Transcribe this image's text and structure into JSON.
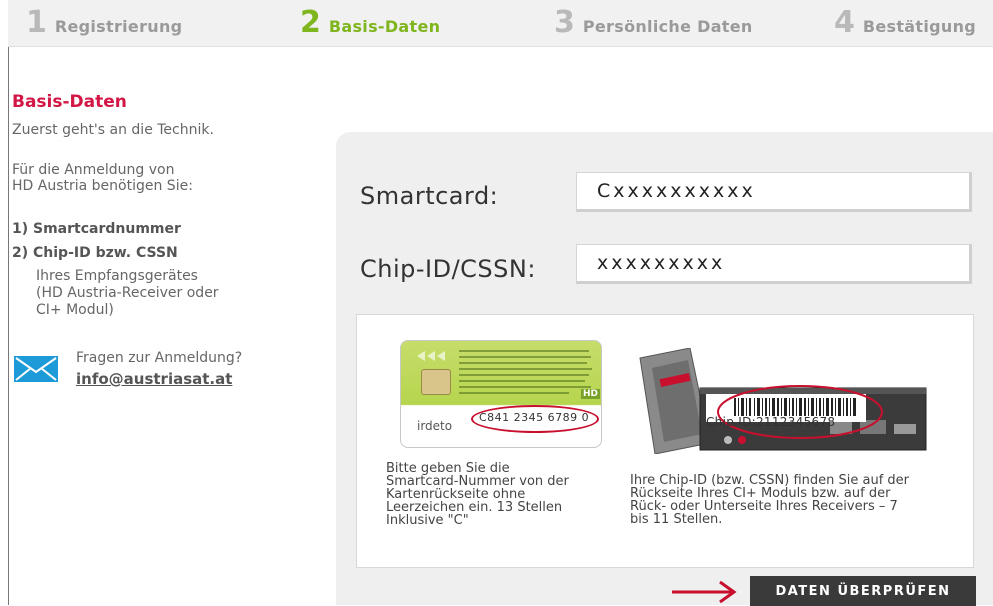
{
  "steps": [
    {
      "num": "1",
      "label": "Registrierung"
    },
    {
      "num": "2",
      "label": "Basis-Daten"
    },
    {
      "num": "3",
      "label": "Persönliche Daten"
    },
    {
      "num": "4",
      "label": "Bestätigung"
    }
  ],
  "sidebar": {
    "title": "Basis-Daten",
    "intro": "Zuerst geht's an die Technik.",
    "need_line1": "Für die Anmeldung von",
    "need_line2": "HD Austria benötigen Sie:",
    "req1": "1) Smartcardnummer",
    "req2": "2) Chip-ID bzw. CSSN",
    "req2_sub1": "Ihres Empfangsgerätes",
    "req2_sub2": "(HD Austria-Receiver oder",
    "req2_sub3": "CI+ Modul)",
    "question": "Fragen zur Anmeldung?",
    "email": "info@austriasat.at"
  },
  "form": {
    "smartcard_label": "Smartcard:",
    "smartcard_value": "Cxxxxxxxxxx",
    "chipid_label": "Chip-ID/CSSN:",
    "chipid_value": "xxxxxxxxx",
    "submit_label": "DATEN ÜBERPRÜFEN"
  },
  "info": {
    "card_brand": "irdeto",
    "card_number": "C841 2345 6789 0",
    "card_hd": "HD",
    "chip_id_text": "Chip ID:2112345678",
    "card_caption_1": "Bitte geben Sie die",
    "card_caption_2": "Smartcard-Nummer von der",
    "card_caption_3": "Kartenrückseite ohne",
    "card_caption_4": "Leerzeichen ein. 13 Stellen",
    "card_caption_5": "Inklusive \"C\"",
    "module_caption_1": "Ihre Chip-ID (bzw. CSSN) finden Sie auf der",
    "module_caption_2": "Rückseite Ihres CI+ Moduls bzw. auf der",
    "module_caption_3": "Rück- oder Unterseite Ihres Receivers – 7",
    "module_caption_4": "bis 11 Stellen."
  },
  "colors": {
    "active_step": "#7fb51d",
    "title_red": "#d21645",
    "button_dark": "#3a3a3a",
    "mail_blue": "#1d9bd8"
  }
}
